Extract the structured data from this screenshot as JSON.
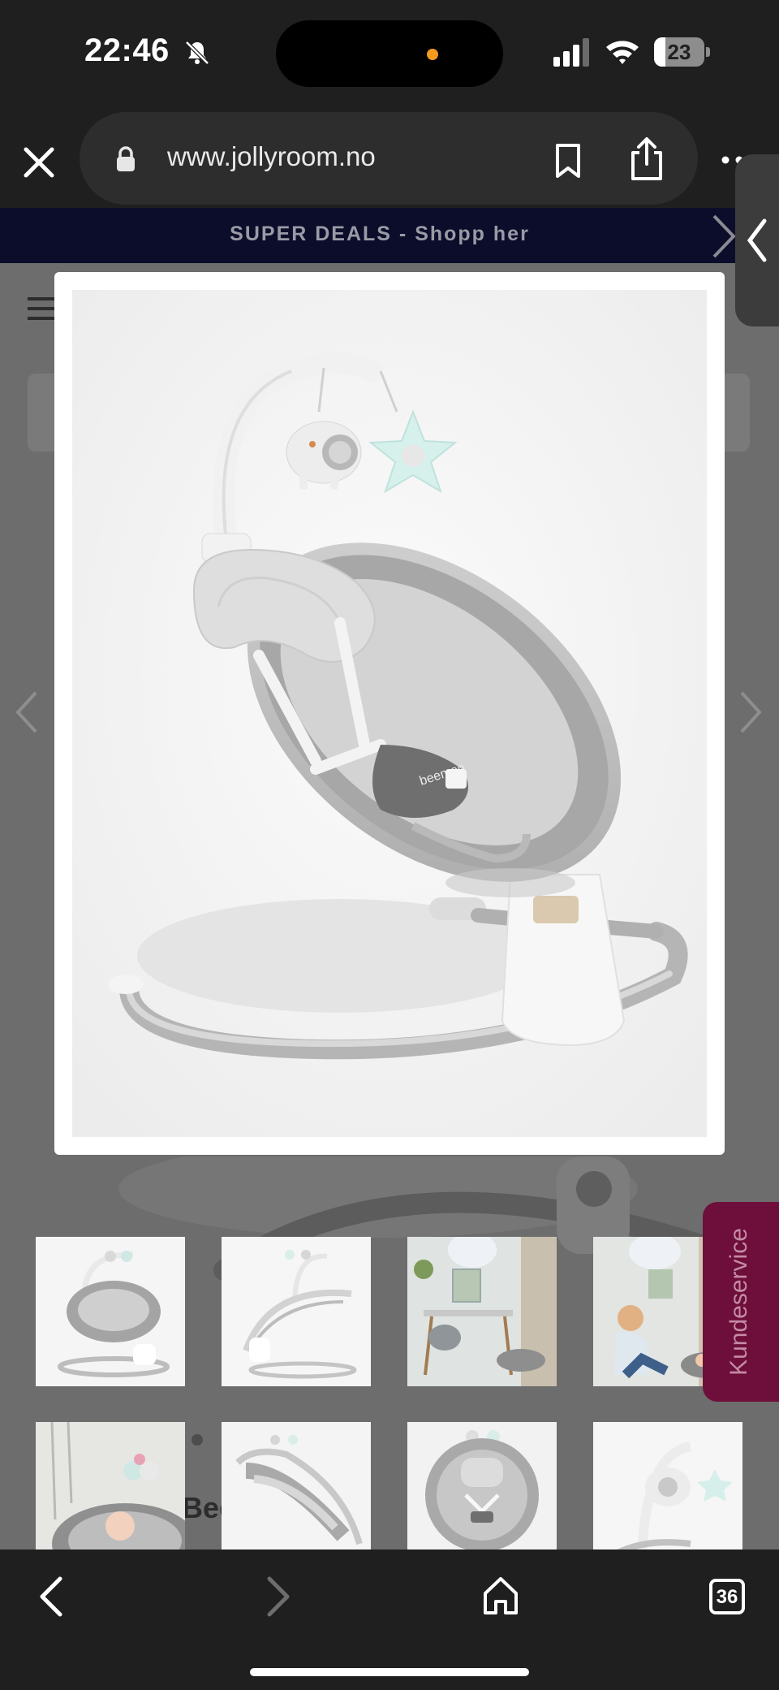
{
  "status_bar": {
    "time": "22:46",
    "battery_percent": "23",
    "battery_level": 0.23
  },
  "browser": {
    "url": "www.jollyroom.no",
    "open_tabs_count": "36"
  },
  "page": {
    "banner_text": "SUPER DEALS - Shopp her",
    "customer_service_tab": "Kundeservice",
    "product_title_partial": "Bee                Y"
  },
  "gallery": {
    "thumbnails": [
      {
        "label": "swing-front"
      },
      {
        "label": "swing-side"
      },
      {
        "label": "lifestyle-room"
      },
      {
        "label": "lifestyle-parent"
      },
      {
        "label": "baby-in-swing"
      },
      {
        "label": "swing-reclined"
      },
      {
        "label": "swing-top"
      },
      {
        "label": "swing-mobile-toys"
      }
    ]
  },
  "colors": {
    "browser_chrome": "#1f1f1f",
    "banner_bg": "#0b0d2a",
    "customer_tab": "#6d0f3a",
    "recording_dot": "#f39a1f"
  }
}
